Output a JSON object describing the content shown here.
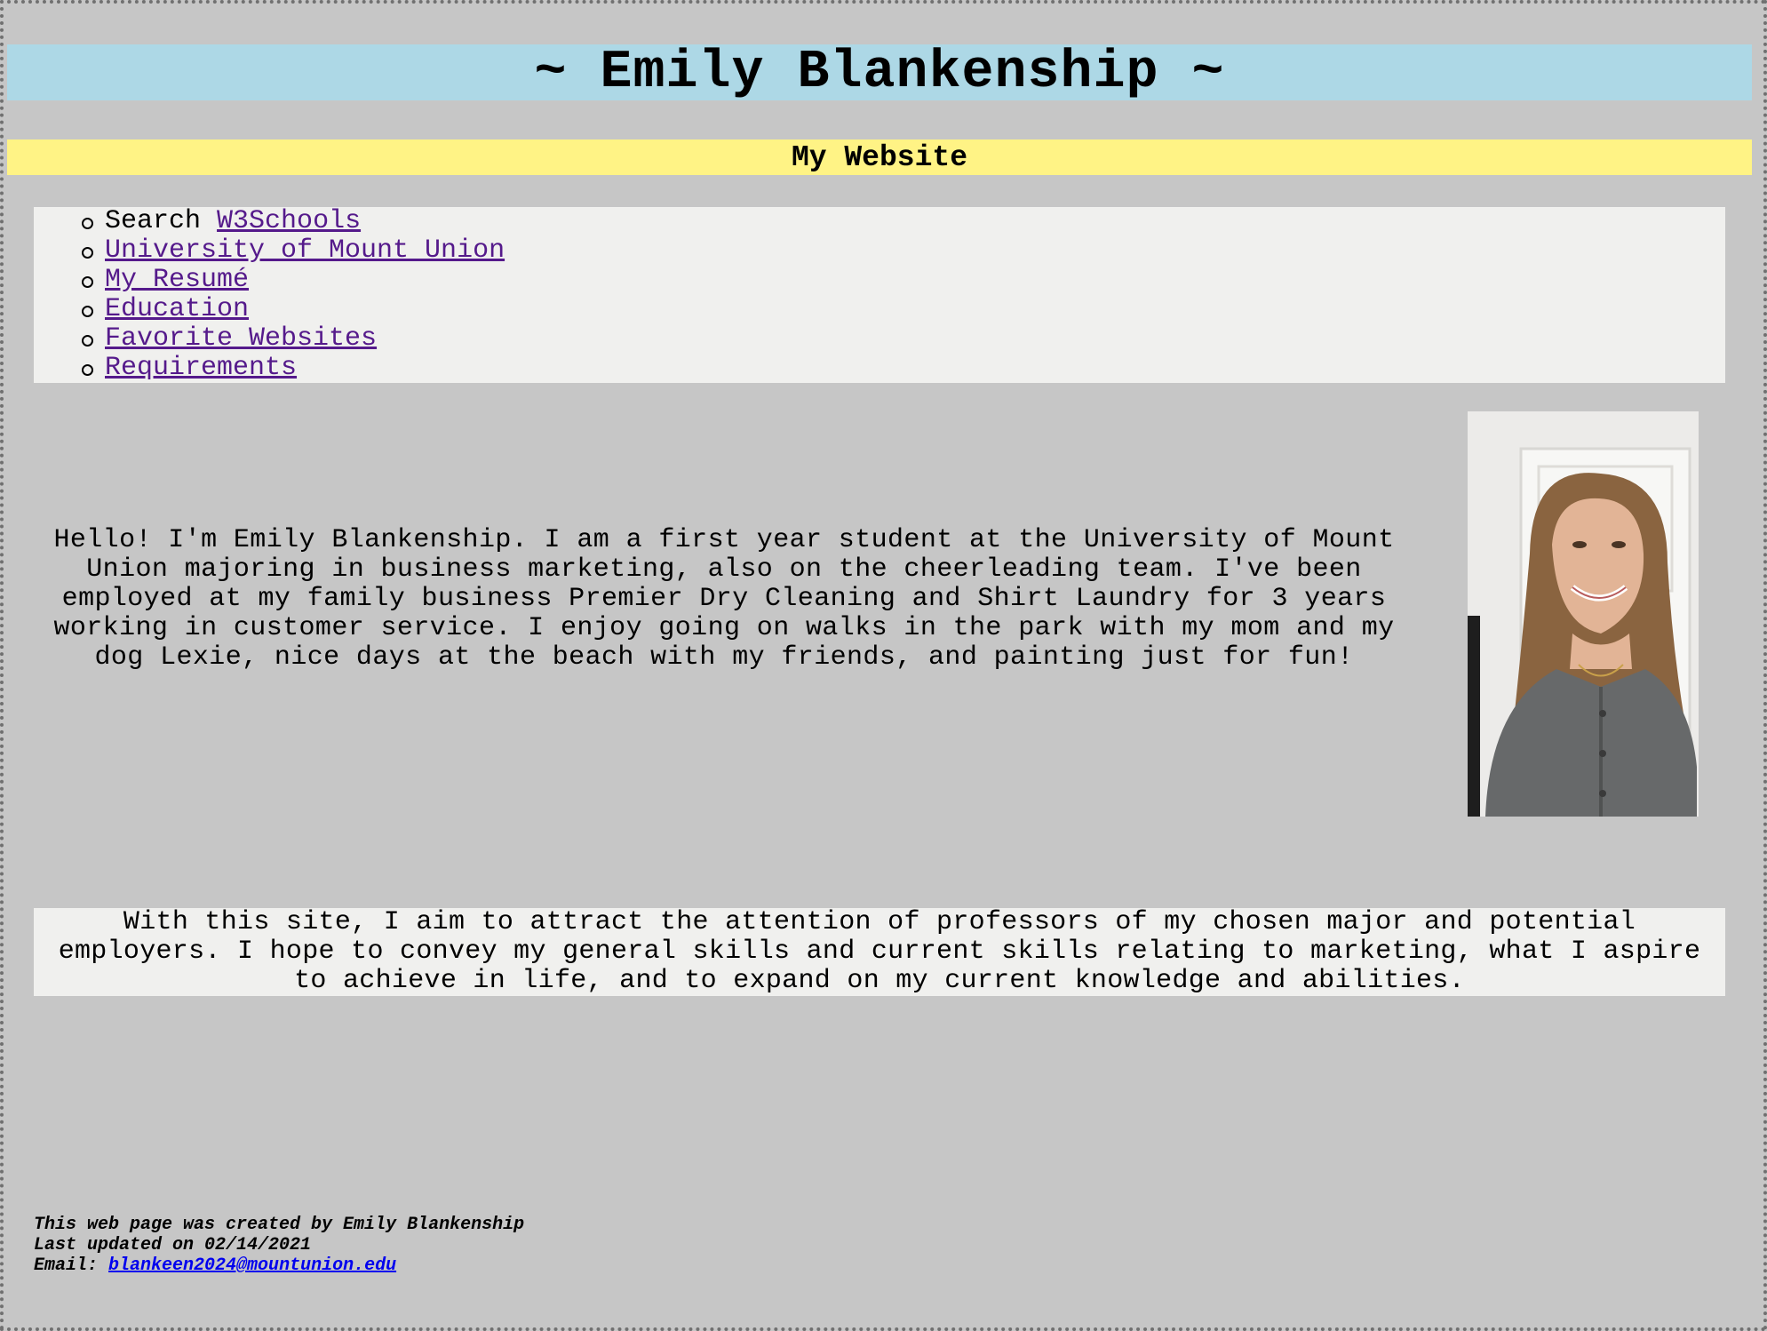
{
  "header": {
    "title": "~ Emily Blankenship ~",
    "subtitle": "My Website"
  },
  "nav": {
    "search_prefix": "Search",
    "items": [
      {
        "label": "W3Schools"
      },
      {
        "label": "University of Mount Union"
      },
      {
        "label": "My Resumé"
      },
      {
        "label": "Education"
      },
      {
        "label": "Favorite Websites"
      },
      {
        "label": "Requirements"
      }
    ]
  },
  "intro": {
    "text": "Hello! I'm Emily Blankenship. I am a first year student at the University of Mount Union majoring in business marketing, also on the cheerleading team. I've been employed at my family business Premier Dry Cleaning and Shirt Laundry for 3 years working in customer service. I enjoy going on walks in the park with my mom and my dog Lexie, nice days at the beach with my friends, and painting just for fun!"
  },
  "aim": {
    "text": "With this site, I aim to attract the attention of professors of my chosen major and potential employers. I hope to convey my general skills and current skills relating to marketing, what I aspire to achieve in life, and to expand on my current knowledge and abilities."
  },
  "footer": {
    "created_by": "This web page was created by Emily Blankenship",
    "last_updated": "Last updated on 02/14/2021",
    "email_label": "Email:",
    "email": "blankeen2024@mountunion.edu"
  },
  "colors": {
    "page_bg": "#c6c6c6",
    "title_bar": "#add8e6",
    "subtitle_bar": "#fff385",
    "box_bg": "#f0f0ee",
    "visited_link": "#551a8b",
    "link": "#0000ee"
  }
}
